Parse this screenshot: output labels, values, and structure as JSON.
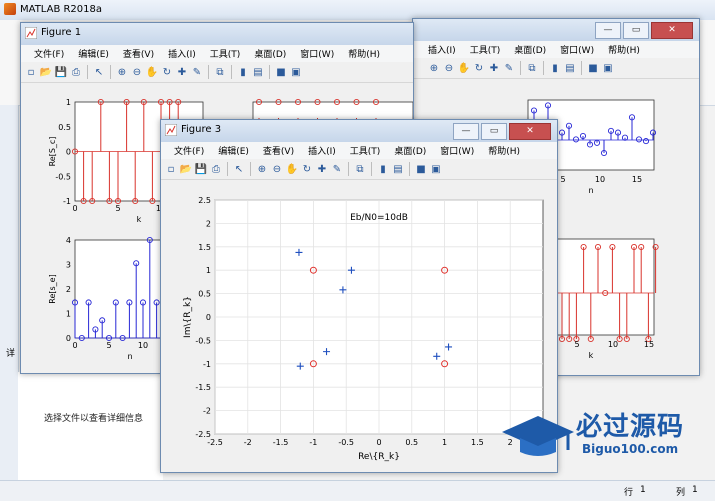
{
  "matlab": {
    "title": "MATLAB R2018a",
    "detail_hint": "选择文件以查看详细信息",
    "status_row_label": "行",
    "status_row_value": "1",
    "status_col_label": "列",
    "status_col_value": "1",
    "side_label": "详"
  },
  "menus": [
    "文件(F)",
    "编辑(E)",
    "查看(V)",
    "插入(I)",
    "工具(T)",
    "桌面(D)",
    "窗口(W)",
    "帮助(H)"
  ],
  "menus_partial": [
    "插入(I)",
    "工具(T)",
    "桌面(D)",
    "窗口(W)",
    "帮助(H)"
  ],
  "figure1": {
    "title": "Figure 1",
    "top_left": {
      "ylabel": "Re[S_c]",
      "xlabel": "k",
      "ylim": [
        -1,
        1
      ],
      "yticks": [
        "1",
        "0.5",
        "0",
        "-0.5",
        "-1"
      ],
      "xticks": [
        "0",
        "5",
        "10"
      ],
      "values": [
        0,
        -1,
        -1,
        1,
        -1,
        -1,
        1,
        -1,
        1,
        -1,
        1,
        1,
        1
      ]
    },
    "bottom_left": {
      "ylabel": "Re[s_e]",
      "xlabel": "n",
      "ylim": [
        0,
        4
      ],
      "yticks": [
        "4",
        "3",
        "2",
        "1",
        "0"
      ],
      "xticks": [
        "0",
        "5",
        "10"
      ],
      "values": [
        1.45,
        0,
        1.45,
        0.35,
        0.72,
        0,
        1.45,
        0,
        1.45,
        3.05,
        1.45,
        4.0,
        1.45,
        0
      ]
    }
  },
  "figure_right": {
    "top_right": {
      "xlabel": "n",
      "xticks": [
        "5",
        "10",
        "15"
      ],
      "values": [
        3.5,
        1.2,
        3.8,
        2.5,
        2.2,
        2.6,
        1.8,
        2.0,
        1.5,
        1.6,
        1.0,
        2.3,
        2.2,
        1.9,
        3.1,
        1.8,
        1.7,
        2.2
      ]
    },
    "bottom_right": {
      "xlabel": "k",
      "xticks": [
        "5",
        "10",
        "15"
      ],
      "values": [
        -1,
        -1,
        -1,
        1,
        -1,
        1,
        0,
        1,
        -1,
        -1,
        1,
        1,
        -1,
        1
      ]
    }
  },
  "figure3": {
    "title": "Figure 3",
    "chart_data": {
      "type": "scatter",
      "title": "Eb/N0=10dB",
      "xlabel": "Re\\{R_k}",
      "ylabel": "Im\\{R_k}",
      "xlim": [
        -2.5,
        2.5
      ],
      "ylim": [
        -2.5,
        2.5
      ],
      "grid": true,
      "xticks": [
        "-2.5",
        "-2",
        "-1.5",
        "-1",
        "-0.5",
        "0",
        "0.5",
        "1",
        "1.5",
        "2"
      ],
      "yticks": [
        "2.5",
        "2",
        "1.5",
        "1",
        "0.5",
        "0",
        "-0.5",
        "-1",
        "-1.5",
        "-2",
        "-2.5"
      ],
      "series": [
        {
          "marker": "plus",
          "color": "#1f4fbf",
          "x": [
            -1.22,
            -0.42,
            -0.55,
            -0.8,
            -1.2,
            0.88,
            1.06
          ],
          "y": [
            1.38,
            1.0,
            0.58,
            -0.74,
            -1.05,
            -0.84,
            -0.64
          ]
        },
        {
          "marker": "circle",
          "color": "#e0322d",
          "x": [
            -1.0,
            1.0,
            -1.0,
            1.0
          ],
          "y": [
            1.0,
            1.0,
            -1.0,
            -1.0
          ]
        }
      ]
    }
  },
  "watermark": {
    "brand": "必过源码",
    "site": "Biguo100.com"
  },
  "colors": {
    "stem_red": "#d9322b",
    "stem_blue": "#2727d6",
    "axes_bg": "#ffffff",
    "window_border": "#6d8bb0"
  }
}
